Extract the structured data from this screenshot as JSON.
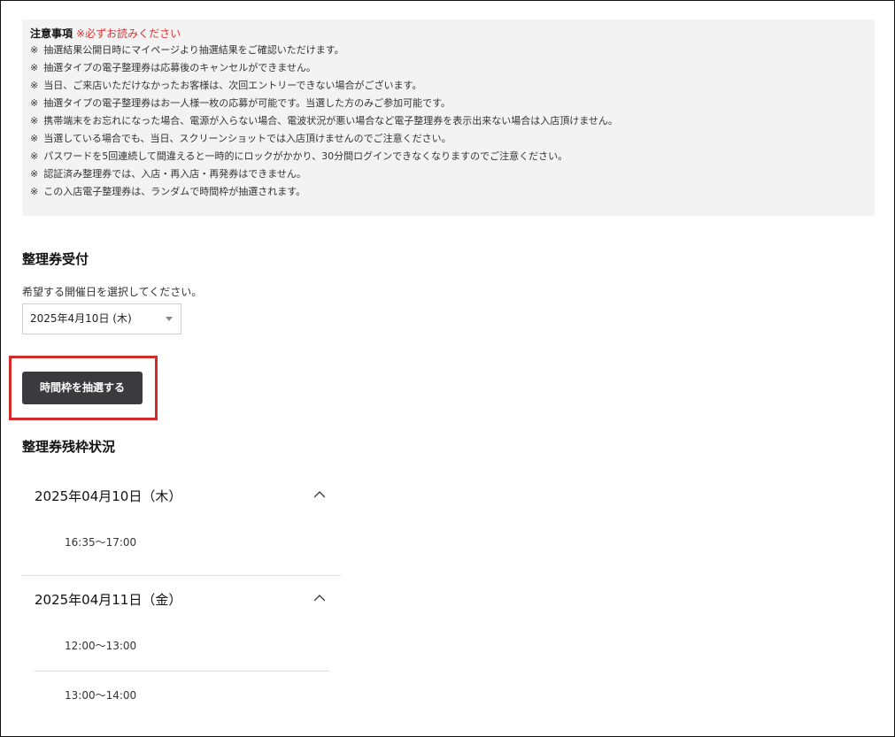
{
  "notice": {
    "title": "注意事項",
    "warning": "※必ずお読みください",
    "mark": "※",
    "items": [
      "抽選結果公開日時にマイページより抽選結果をご確認いただけます。",
      "抽選タイプの電子整理券は応募後のキャンセルができません。",
      "当日、ご来店いただけなかったお客様は、次回エントリーできない場合がございます。",
      "抽選タイプの電子整理券はお一人様一枚の応募が可能です。当選した方のみご参加可能です。",
      "携帯端末をお忘れになった場合、電源が入らない場合、電波状況が悪い場合など電子整理券を表示出来ない場合は入店頂けません。",
      "当選している場合でも、当日、スクリーンショットでは入店頂けませんのでご注意ください。",
      "パスワードを5回連続して間違えると一時的にロックがかかり、30分間ログインできなくなりますのでご注意ください。",
      "認証済み整理券では、入店・再入店・再発券はできません。",
      "この入店電子整理券は、ランダムで時間枠が抽選されます。"
    ]
  },
  "reception": {
    "title": "整理券受付",
    "prompt": "希望する開催日を選択してください。",
    "selected_date": "2025年4月10日 (木)",
    "button_label": "時間枠を抽選する"
  },
  "status": {
    "title": "整理券残枠状況",
    "days": [
      {
        "date": "2025年04月10日（木）",
        "slots": [
          "16:35〜17:00"
        ]
      },
      {
        "date": "2025年04月11日（金）",
        "slots": [
          "12:00〜13:00",
          "13:00〜14:00"
        ]
      }
    ]
  },
  "icons": {
    "select_arrow": "chevron-down-icon",
    "collapse": "chevron-up-icon"
  },
  "colors": {
    "warning": "#d33333",
    "button_bg": "#3b3b3f",
    "highlight": "#d42a2a",
    "notice_bg": "#f3f3f3"
  }
}
